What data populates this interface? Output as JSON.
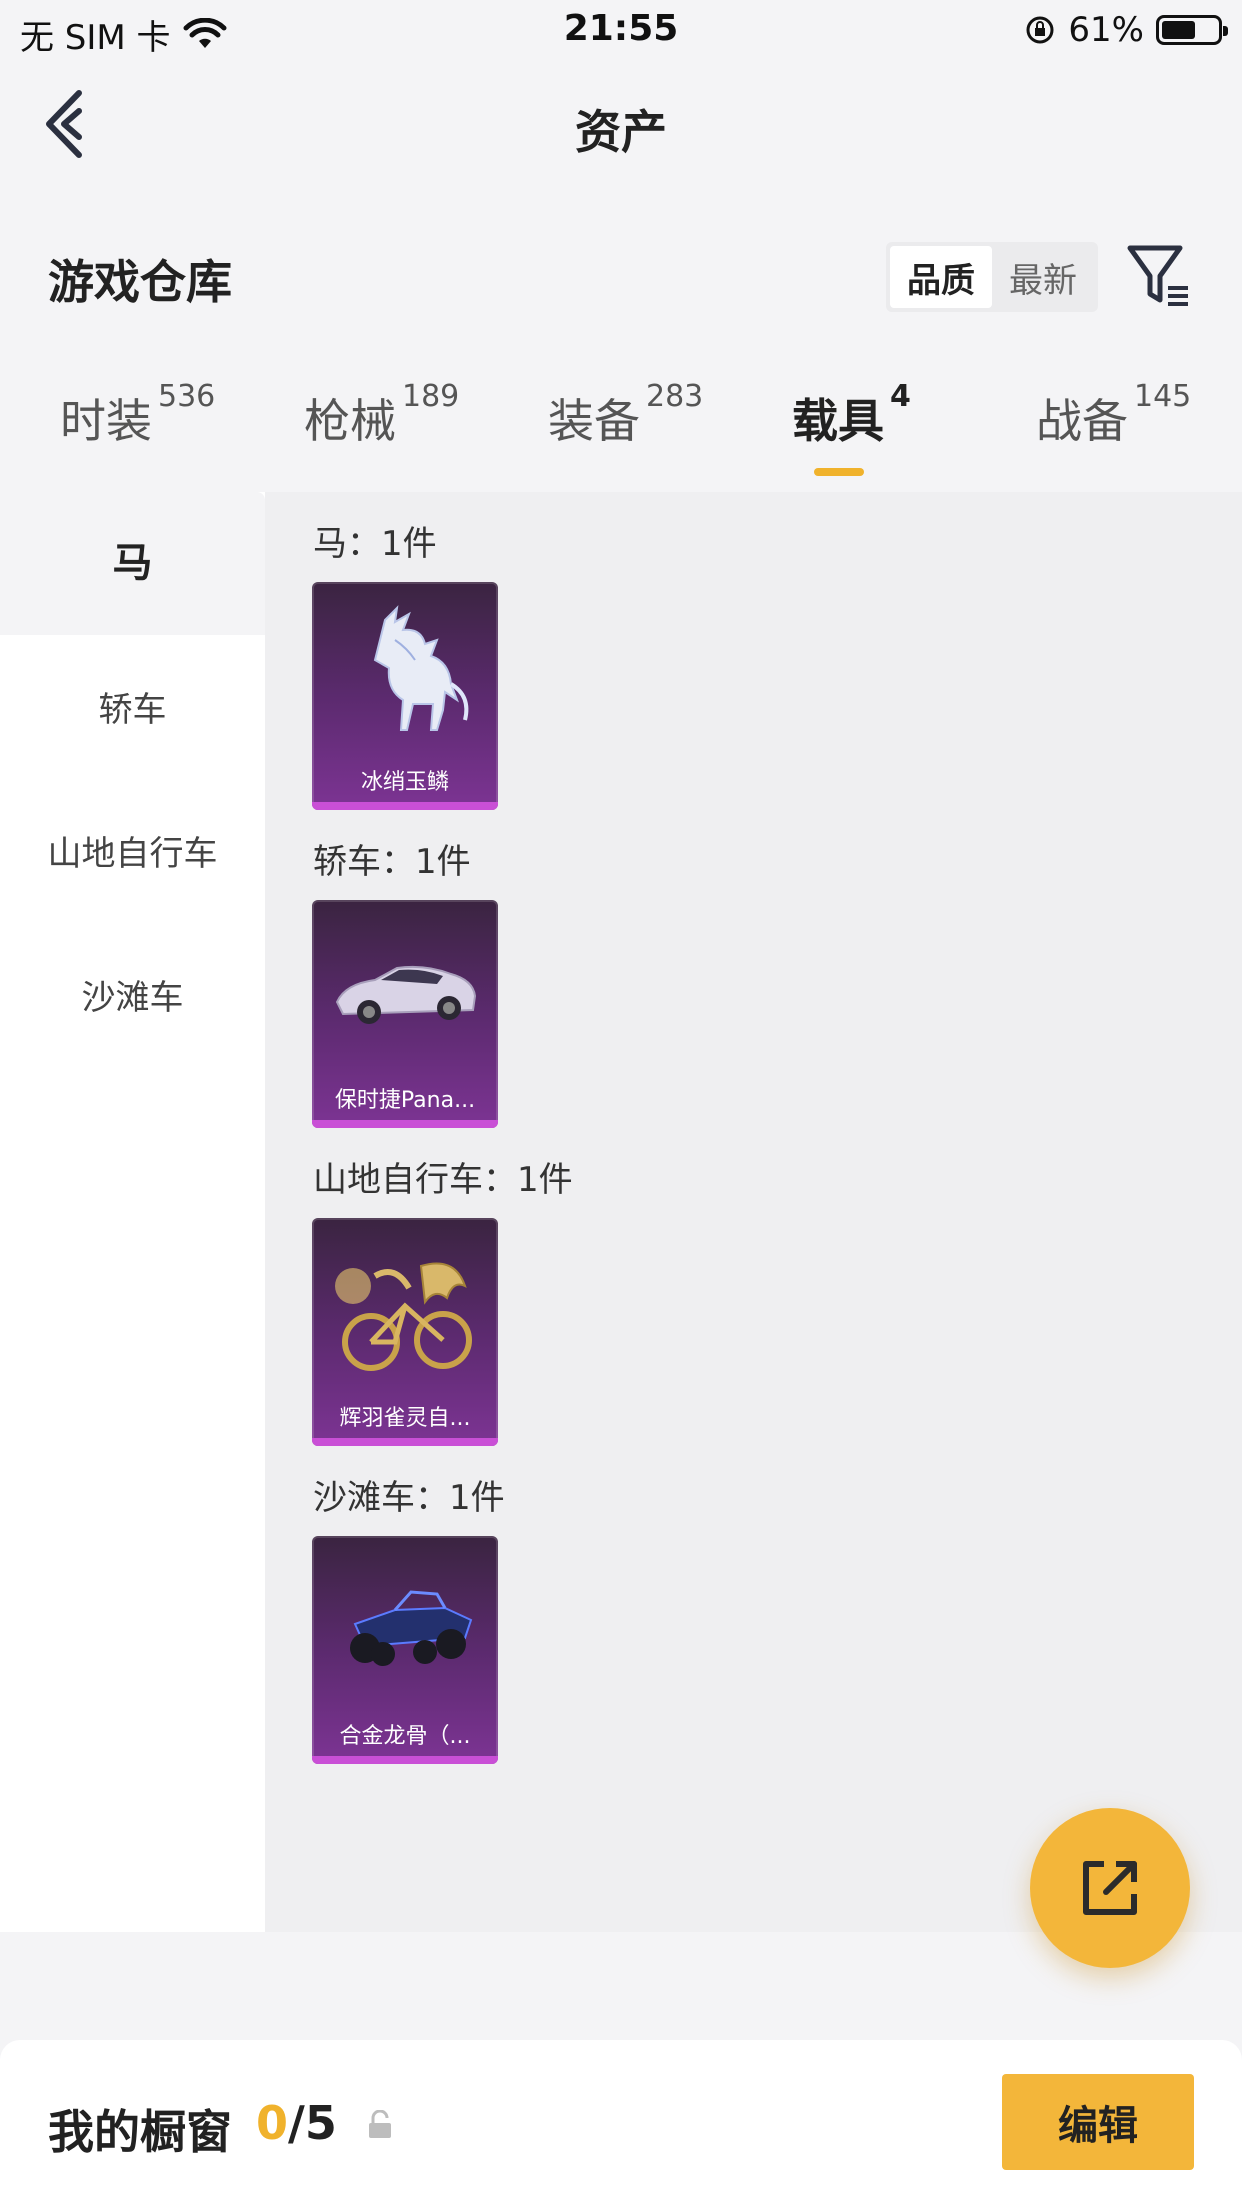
{
  "status": {
    "carrier": "无 SIM 卡",
    "time": "21:55",
    "battery": "61%",
    "battery_level": 0.61
  },
  "nav": {
    "title": "资产",
    "back_icon": "chevron-left-icon"
  },
  "header": {
    "title": "游戏仓库",
    "sort_options": [
      "品质",
      "最新"
    ],
    "sort_selected": "品质",
    "filter_icon": "filter-icon"
  },
  "tabs": [
    {
      "label": "时装",
      "count": "536"
    },
    {
      "label": "枪械",
      "count": "189"
    },
    {
      "label": "装备",
      "count": "283"
    },
    {
      "label": "载具",
      "count": "4"
    },
    {
      "label": "战备",
      "count": "145"
    }
  ],
  "active_tab": "载具",
  "sidebar": {
    "items": [
      "马",
      "轿车",
      "山地自行车",
      "沙滩车"
    ],
    "active": "马"
  },
  "groups": [
    {
      "label": "马：1件",
      "items": [
        {
          "name": "冰绡玉鳞",
          "art": "ice-horse"
        }
      ]
    },
    {
      "label": "轿车：1件",
      "items": [
        {
          "name": "保时捷Pana...",
          "art": "sedan-car"
        }
      ]
    },
    {
      "label": "山地自行车：1件",
      "items": [
        {
          "name": "辉羽雀灵自...",
          "art": "golden-bike"
        }
      ]
    },
    {
      "label": "沙滩车：1件",
      "items": [
        {
          "name": "合金龙骨（...",
          "art": "buggy"
        }
      ]
    }
  ],
  "share_icon": "share-external-icon",
  "showcase": {
    "title": "我的橱窗",
    "current": "0",
    "total": "/5",
    "lock_icon": "lock-icon",
    "edit_label": "编辑"
  },
  "colors": {
    "accent": "#f3b63a",
    "card_purple": "#7d3494",
    "card_bottom": "#c94fd6"
  }
}
